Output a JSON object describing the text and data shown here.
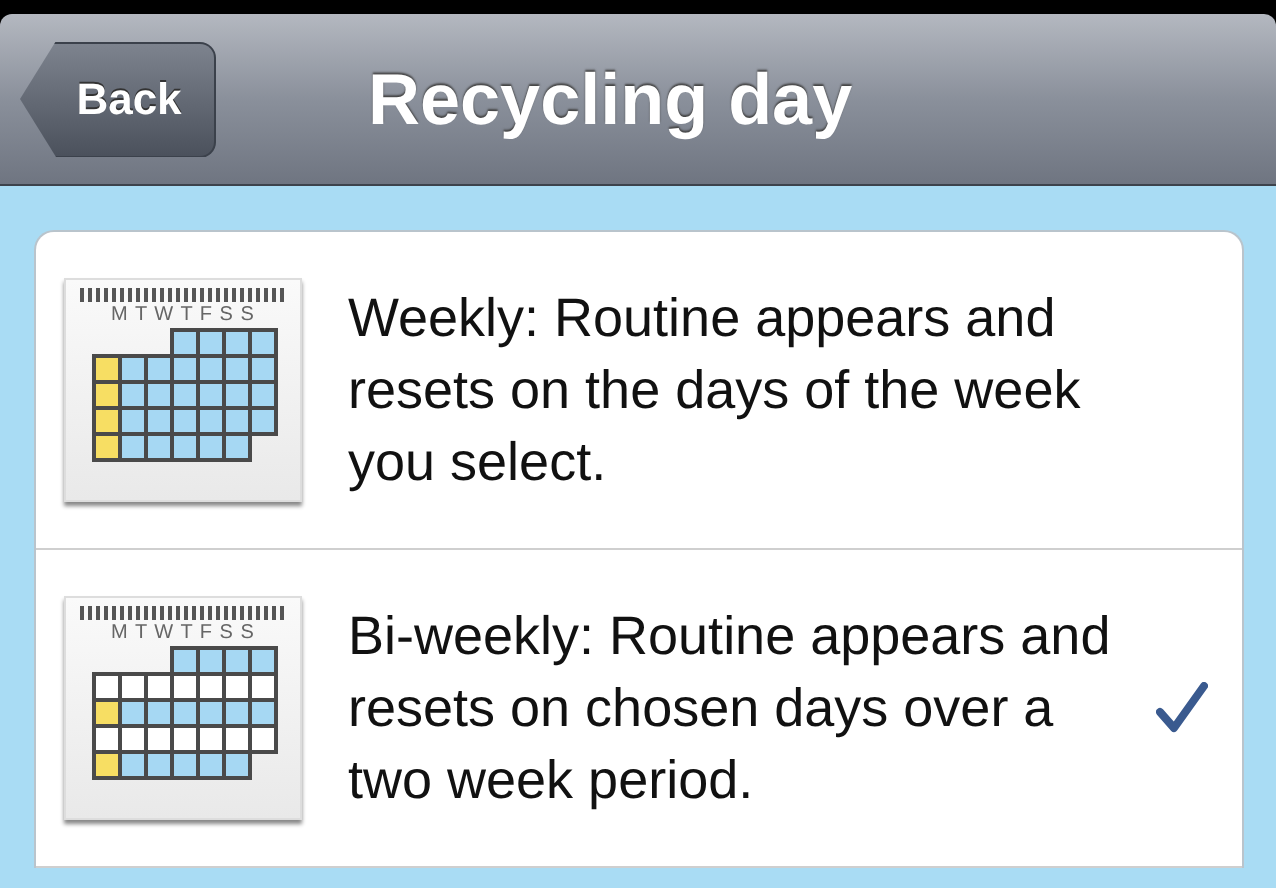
{
  "nav": {
    "back": "Back",
    "title": "Recycling day"
  },
  "options": [
    {
      "kind": "weekly",
      "weekdays": "M T W T F S S",
      "text": "Weekly: Routine appears and resets on the days of the week you select.",
      "selected": false
    },
    {
      "kind": "biweekly",
      "weekdays": "M T W T F S S",
      "text": "Bi-weekly: Routine appears and resets on chosen days over a two week period.",
      "selected": true
    }
  ]
}
